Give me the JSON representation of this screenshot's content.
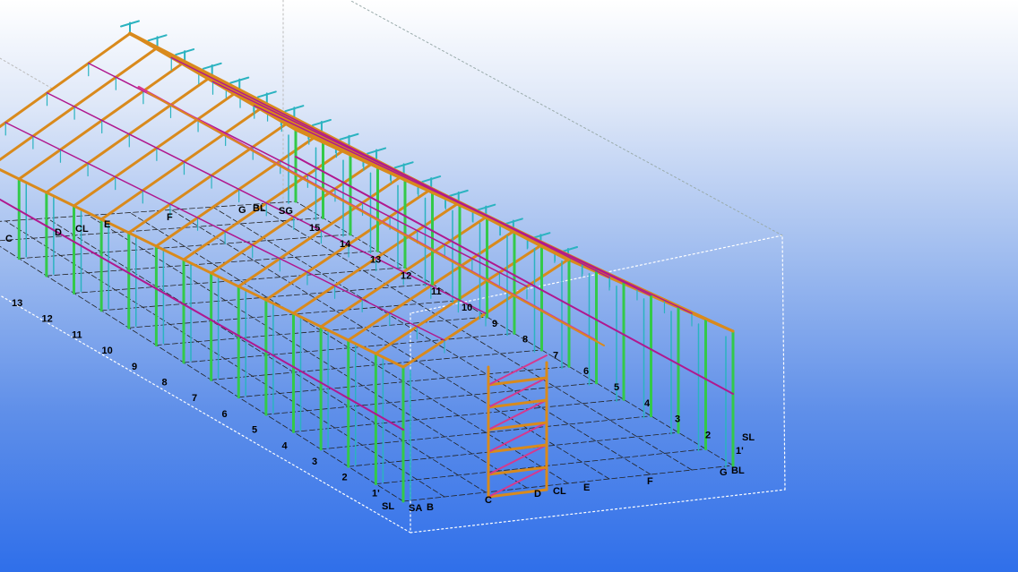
{
  "model": {
    "grid_bay_labels_left": [
      "13",
      "12",
      "11",
      "10",
      "9",
      "8",
      "7",
      "6",
      "5",
      "4",
      "3",
      "2",
      "1'"
    ],
    "grid_bay_labels_right": [
      "15",
      "14",
      "13",
      "12",
      "11",
      "10",
      "9",
      "8",
      "7",
      "6",
      "5",
      "4",
      "3",
      "2",
      "1'"
    ],
    "grid_lines_far_end": [
      "C",
      "D",
      "CL",
      "E",
      "F",
      "G",
      "BL",
      "SG"
    ],
    "grid_lines_near_end": [
      "SL",
      "SA",
      "B",
      "C",
      "D",
      "CL",
      "E",
      "F",
      "G",
      "BL",
      "SL"
    ],
    "colors": {
      "column": "#33c94a",
      "rafter": "#d98a1c",
      "truss": "#2bb3c0",
      "purlin": "#b0188f",
      "stair": "#d6388e",
      "grid": "#222222",
      "bbox": "#ffffff"
    }
  }
}
